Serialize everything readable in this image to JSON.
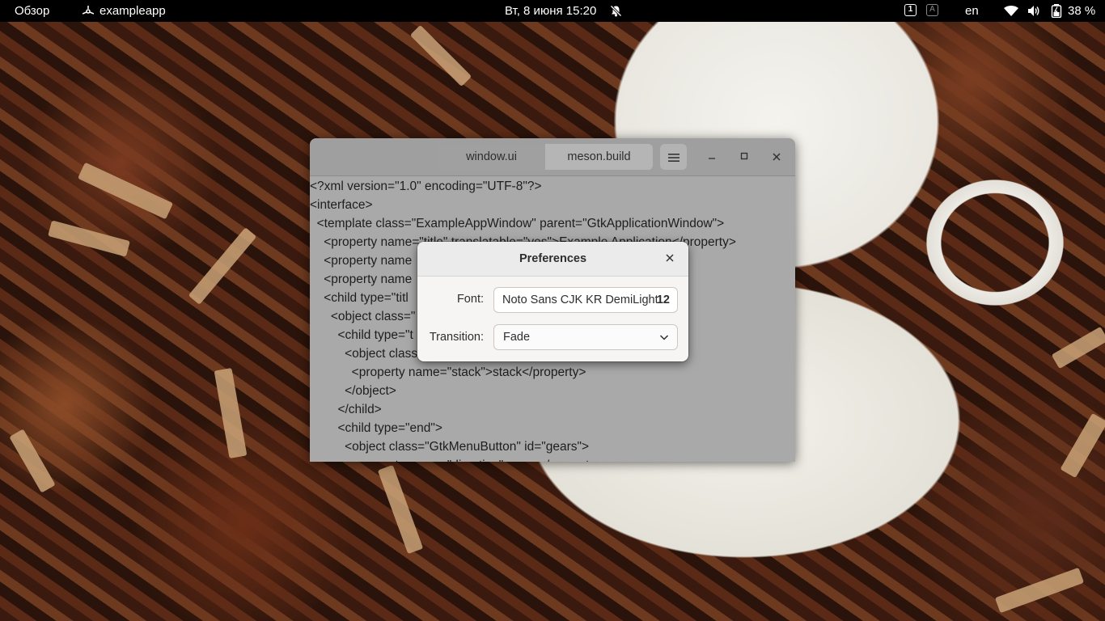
{
  "topbar": {
    "overview": "Обзор",
    "app_name": "exampleapp",
    "clock": "Вт, 8 июня  15:20",
    "workspace_1": "1",
    "workspace_2": "A",
    "language": "en",
    "battery": "38 %",
    "icons": [
      "app-icon",
      "bell-muted-icon",
      "wifi-icon",
      "volume-icon",
      "battery-icon"
    ]
  },
  "window": {
    "tabs": [
      {
        "label": "window.ui",
        "active": true
      },
      {
        "label": "meson.build",
        "active": false
      }
    ],
    "menu_icon": "hamburger-icon",
    "controls": {
      "minimize": "–",
      "maximize": "☐",
      "close": "✕"
    },
    "code_lines": [
      "<?xml version=\"1.0\" encoding=\"UTF-8\"?>",
      "<interface>",
      "  <template class=\"ExampleAppWindow\" parent=\"GtkApplicationWindow\">",
      "    <property name=\"title\" translatable=\"yes\">Example Application</property>",
      "    <property name",
      "    <property name",
      "    <child type=\"titl",
      "      <object class=\"",
      "        <child type=\"t",
      "          <object class",
      "            <property name=\"stack\">stack</property>",
      "          </object>",
      "        </child>",
      "        <child type=\"end\">",
      "          <object class=\"GtkMenuButton\" id=\"gears\">",
      "            <property name=\"direction\">none</property>"
    ]
  },
  "dialog": {
    "title": "Preferences",
    "close": "✕",
    "font_label": "Font:",
    "font_name": "Noto Sans CJK KR DemiLight",
    "font_size": "12",
    "transition_label": "Transition:",
    "transition_value": "Fade"
  }
}
